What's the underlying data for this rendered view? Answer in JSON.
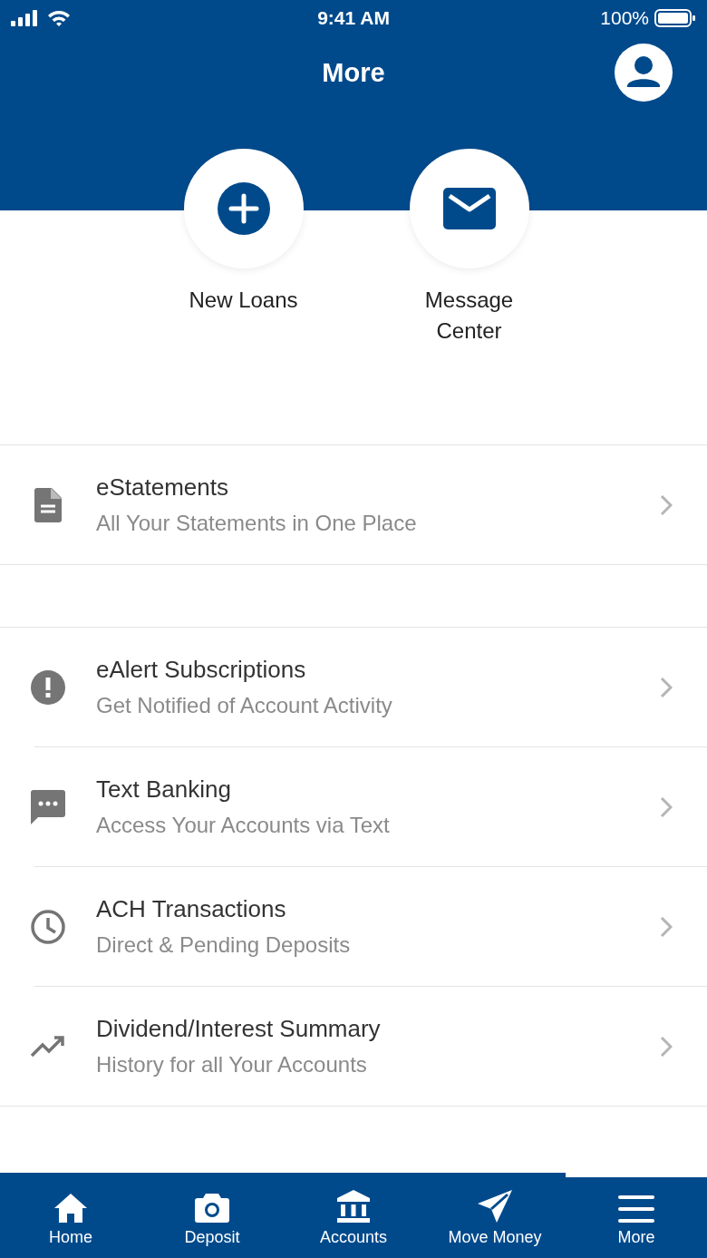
{
  "status_bar": {
    "time": "9:41 AM",
    "battery": "100%"
  },
  "header": {
    "title": "More"
  },
  "shortcuts": [
    {
      "kind": "plus",
      "label": "New Loans"
    },
    {
      "kind": "mail",
      "label": "Message Center"
    }
  ],
  "sections": [
    [
      {
        "kind": "document",
        "title": "eStatements",
        "subtitle": "All Your Statements in One Place"
      }
    ],
    [
      {
        "kind": "alert",
        "title": "eAlert Subscriptions",
        "subtitle": "Get Notified of Account Activity"
      },
      {
        "kind": "chat",
        "title": "Text Banking",
        "subtitle": "Access Your Accounts via Text"
      },
      {
        "kind": "clock",
        "title": "ACH Transactions",
        "subtitle": "Direct & Pending Deposits"
      },
      {
        "kind": "trend",
        "title": "Dividend/Interest Summary",
        "subtitle": "History for all Your Accounts"
      }
    ]
  ],
  "tab_bar": [
    {
      "kind": "home",
      "label": "Home",
      "selected": false
    },
    {
      "kind": "camera",
      "label": "Deposit",
      "selected": false
    },
    {
      "kind": "bank",
      "label": "Accounts",
      "selected": false
    },
    {
      "kind": "send",
      "label": "Move Money",
      "selected": false
    },
    {
      "kind": "menu",
      "label": "More",
      "selected": true
    }
  ]
}
